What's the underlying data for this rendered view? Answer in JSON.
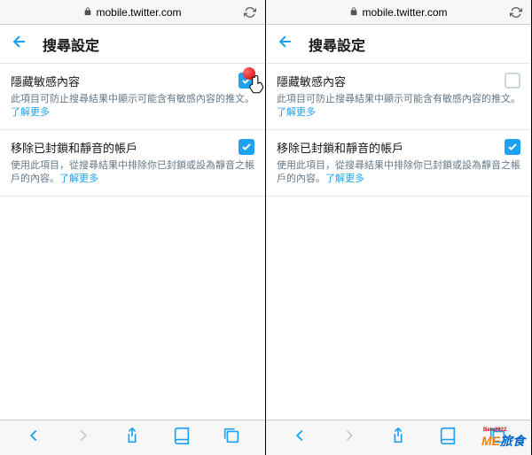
{
  "url": "mobile.twitter.com",
  "header_title": "搜尋設定",
  "settings": [
    {
      "title": "隱藏敏感內容",
      "desc": "此項目可防止搜尋結果中顯示可能含有敏感內容的推文。",
      "learn_more": "了解更多"
    },
    {
      "title": "移除已封鎖和靜音的帳戶",
      "desc": "使用此項目，從搜尋結果中排除你已封鎖或設為靜音之帳戶的內容。",
      "learn_more": "了解更多"
    }
  ],
  "left_checks": [
    true,
    true
  ],
  "right_checks": [
    false,
    true
  ],
  "watermark": {
    "me": "ME",
    "text": "旅食",
    "sub": "Beta2022"
  }
}
